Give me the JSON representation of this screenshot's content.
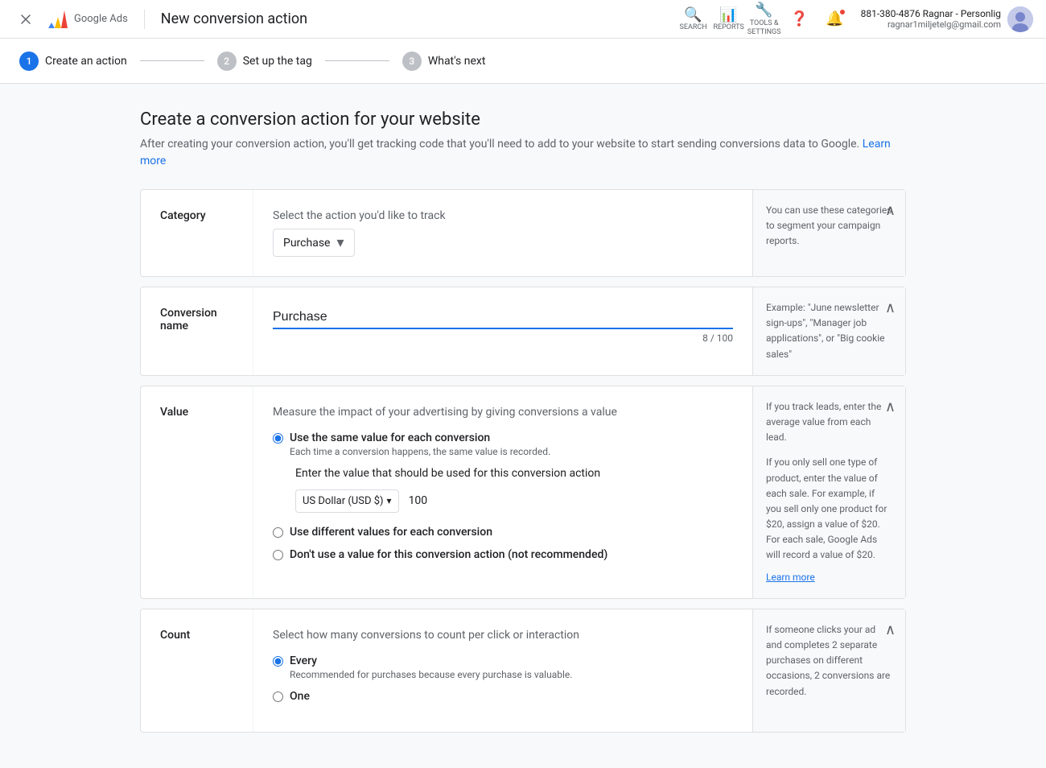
{
  "nav": {
    "title": "New conversion action",
    "search_label": "SEARCH",
    "reports_label": "REPORTS",
    "tools_label": "TOOLS & SETTINGS",
    "help_label": "",
    "user_name": "881-380-4876 Ragnar - Personlig",
    "user_email": "ragnar1miljetelg@gmail.com"
  },
  "stepper": {
    "step1_number": "1",
    "step1_label": "Create an action",
    "step2_number": "2",
    "step2_label": "Set up the tag",
    "step3_number": "3",
    "step3_label": "What's next"
  },
  "page": {
    "title": "Create a conversion action for your website",
    "description": "After creating your conversion action, you'll get tracking code that you'll need to add to your website to start sending conversions data to Google.",
    "learn_more": "Learn more"
  },
  "category": {
    "label": "Category",
    "select_label": "Select the action you'd like to track",
    "selected_value": "Purchase",
    "help_text": "You can use these categories to segment your campaign reports."
  },
  "conversion_name": {
    "label": "Conversion name",
    "value": "Purchase",
    "char_count": "8 / 100",
    "help_text": "Example: \"June newsletter sign-ups\", \"Manager job applications\", or \"Big cookie sales\""
  },
  "value": {
    "label": "Value",
    "description": "Measure the impact of your advertising by giving conversions a value",
    "option1_label": "Use the same value for each conversion",
    "option1_sublabel": "Each time a conversion happens, the same value is recorded.",
    "value_input_label": "Enter the value that should be used for this conversion action",
    "currency": "US Dollar (USD $)",
    "amount": "100",
    "option2_label": "Use different values for each conversion",
    "option3_label": "Don't use a value for this conversion action (not recommended)",
    "help_text1": "If you track leads, enter the average value from each lead.",
    "help_text2": "If you only sell one type of product, enter the value of each sale. For example, if you sell only one product for $20, assign a value of $20. For each sale, Google Ads will record a value of $20.",
    "learn_more": "Learn more"
  },
  "count": {
    "label": "Count",
    "description": "Select how many conversions to count per click or interaction",
    "option1_label": "Every",
    "option1_sublabel": "Recommended for purchases because every purchase is valuable.",
    "option2_label": "One",
    "help_text": "If someone clicks your ad and completes 2 separate purchases on different occasions, 2 conversions are recorded."
  }
}
